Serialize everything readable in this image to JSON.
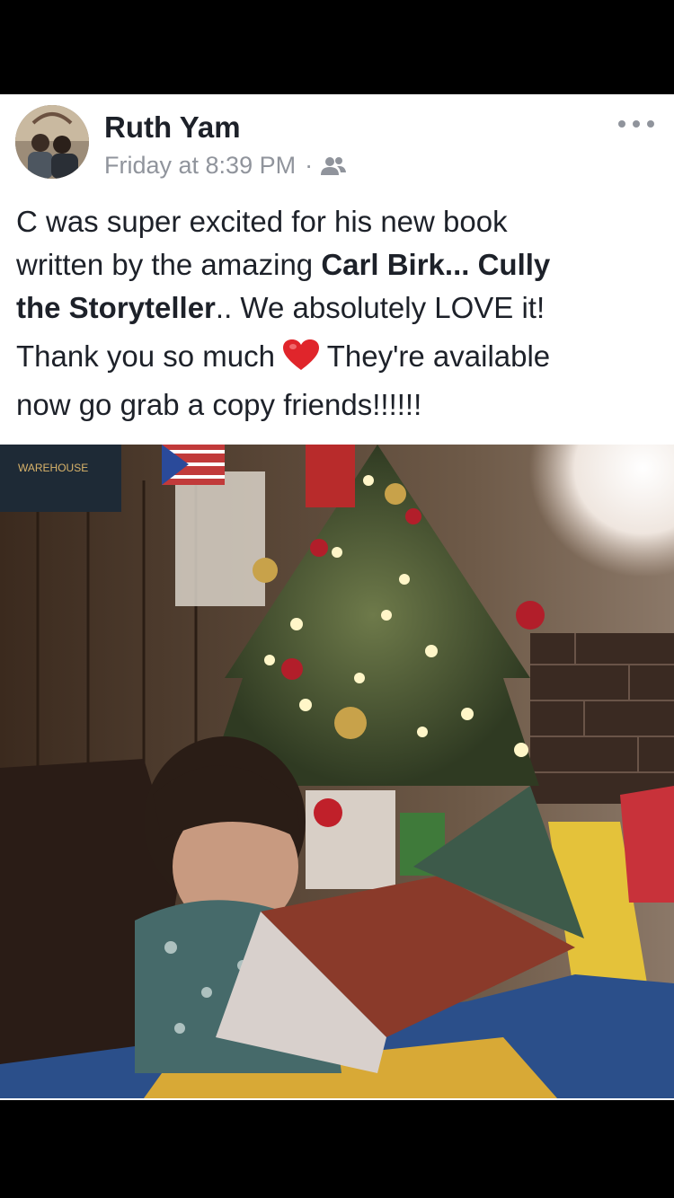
{
  "post": {
    "author": "Ruth Yam",
    "timestamp": "Friday at 8:39 PM",
    "separator": "·",
    "audience_icon": "friends-icon",
    "more_icon": "more-horizontal-icon",
    "text": {
      "l1": "C was super excited for his new book",
      "l2a": "written by the amazing ",
      "l2b": "Carl Birk...  Cully",
      "l3a": "the Storyteller",
      "l3b": ".. We absolutely LOVE it!",
      "l4a": "Thank you so much ",
      "l4b": " They're available",
      "l5": "now go grab a copy friends!!!!!!"
    },
    "emoji_icon": "red-heart-icon",
    "photo_icon": "photo-child-reading-by-christmas-tree"
  },
  "colors": {
    "name": "#1d2129",
    "meta": "#90949c",
    "heart": "#e0252b",
    "background": "#000000"
  }
}
